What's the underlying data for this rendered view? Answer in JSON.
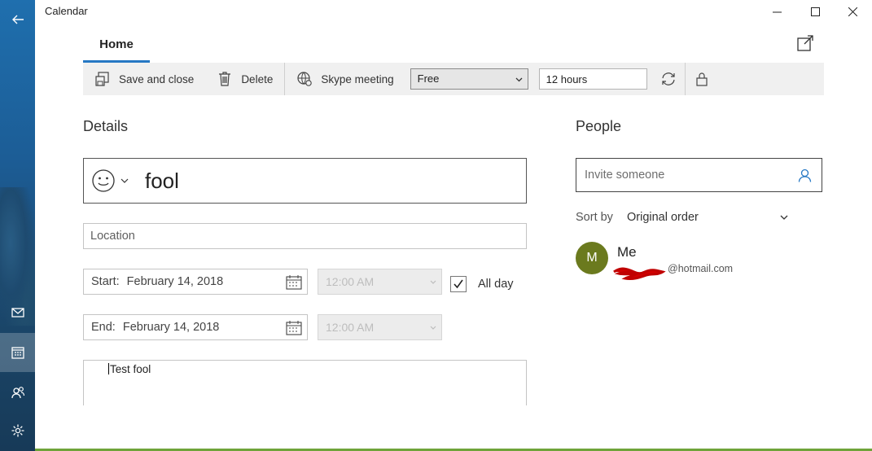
{
  "window": {
    "title": "Calendar"
  },
  "tabs": {
    "home": "Home"
  },
  "toolbar": {
    "save_close": "Save and close",
    "delete": "Delete",
    "skype": "Skype meeting",
    "show_as": "Free",
    "reminder": "12 hours"
  },
  "details": {
    "heading": "Details",
    "title": "fool",
    "location_placeholder": "Location",
    "start_label": "Start:",
    "start_date": "February 14, 2018",
    "start_time": "12:00 AM",
    "end_label": "End:",
    "end_date": "February 14, 2018",
    "end_time": "12:00 AM",
    "all_day_label": "All day",
    "all_day_checked": true,
    "notes": "Test fool"
  },
  "people": {
    "heading": "People",
    "invite_placeholder": "Invite someone",
    "sort_label": "Sort by",
    "sort_value": "Original order",
    "attendees": [
      {
        "initial": "M",
        "name": "Me",
        "email": "@hotmail.com"
      }
    ]
  },
  "colors": {
    "accent": "#2678c4",
    "avatar": "#6b7a1e",
    "rail": "#1c5d96"
  }
}
